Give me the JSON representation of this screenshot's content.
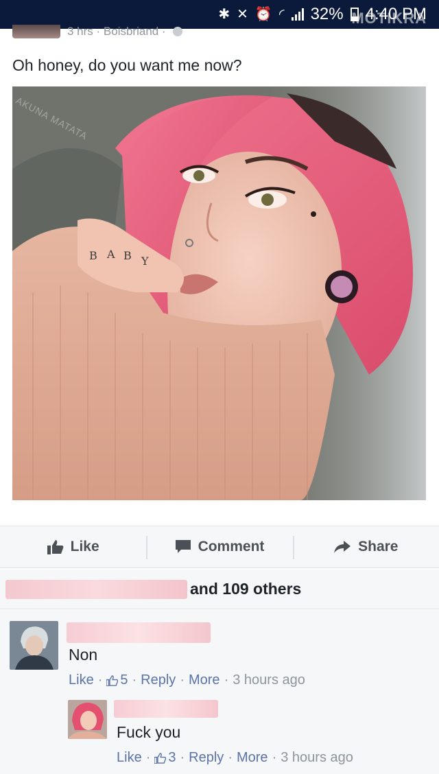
{
  "status_bar": {
    "battery": "32%",
    "time": "4:40 PM",
    "watermark": "MOTIKRA"
  },
  "post": {
    "meta_partial": "3 hrs · Boisbriand ·",
    "text": "Oh honey, do you want me now?",
    "photo": {
      "watermark": "AKUNA MATATA",
      "knuckle_text": "BABY"
    }
  },
  "actions": {
    "like_label": "Like",
    "comment_label": "Comment",
    "share_label": "Share"
  },
  "likes": {
    "summary": "and 109 others"
  },
  "comments": [
    {
      "text": "Non",
      "like_label": "Like",
      "like_count": "5",
      "reply_label": "Reply",
      "more_label": "More",
      "time": "3 hours ago"
    },
    {
      "text": "Fuck you",
      "like_label": "Like",
      "like_count": "3",
      "reply_label": "Reply",
      "more_label": "More",
      "time": "3 hours ago"
    }
  ],
  "colors": {
    "link": "#5a73a8",
    "muted": "#8d949e",
    "status_bar": "#0b1a3a",
    "hair": "#ec5f7d"
  }
}
